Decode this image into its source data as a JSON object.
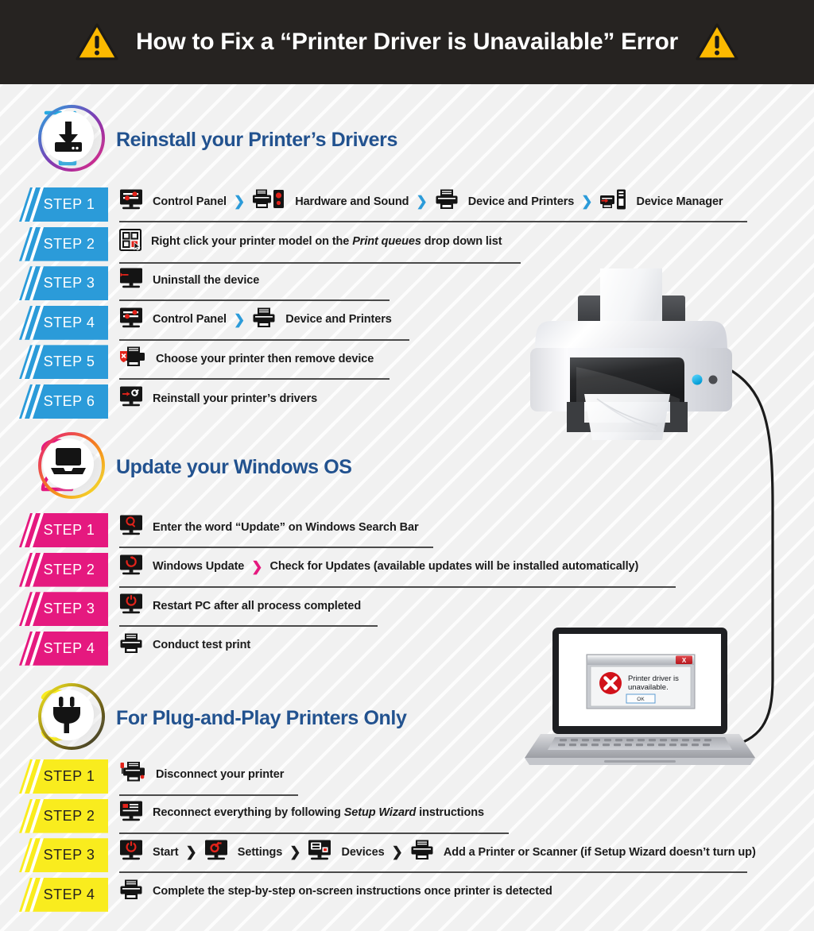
{
  "header": {
    "title": "How to Fix a “Printer Driver is Unavailable” Error",
    "left_icon": "warning-triangle-icon",
    "right_icon": "warning-triangle-icon"
  },
  "colors": {
    "header_bg": "#262321",
    "page_bg": "#f1f1f1",
    "section_title": "#22528f",
    "section1_accent": "#2b9bd9",
    "section2_accent": "#e5197f",
    "section3_accent": "#f9ec1e",
    "warning_yellow": "#fcb900",
    "error_red": "#d91f26"
  },
  "sections": [
    {
      "number": "1",
      "title": "Reinstall your Printer’s Drivers",
      "icon": "download-icon",
      "accent": "#2b9bd9",
      "steps": [
        {
          "badge": "STEP 1",
          "rule_width": 790,
          "parts": [
            {
              "type": "icon",
              "name": "monitor-settings-icon"
            },
            {
              "type": "text",
              "value": "Control Panel"
            },
            {
              "type": "chevron"
            },
            {
              "type": "icon",
              "name": "printer-speaker-icon"
            },
            {
              "type": "text",
              "value": "Hardware and Sound"
            },
            {
              "type": "chevron"
            },
            {
              "type": "icon",
              "name": "printer-icon"
            },
            {
              "type": "text",
              "value": "Device and Printers"
            },
            {
              "type": "chevron"
            },
            {
              "type": "icon",
              "name": "device-manager-icon"
            },
            {
              "type": "text",
              "value": "Device Manager"
            }
          ]
        },
        {
          "badge": "STEP 2",
          "rule_width": 505,
          "parts": [
            {
              "type": "icon",
              "name": "grid-cursor-icon"
            },
            {
              "type": "text",
              "value": "Right click your printer model on the ",
              "italic_after": "Print queues",
              "tail": " drop down list"
            }
          ]
        },
        {
          "badge": "STEP 3",
          "rule_width": 340,
          "parts": [
            {
              "type": "icon",
              "name": "monitor-uninstall-icon"
            },
            {
              "type": "text",
              "value": "Uninstall the device"
            }
          ]
        },
        {
          "badge": "STEP 4",
          "rule_width": 365,
          "parts": [
            {
              "type": "icon",
              "name": "monitor-settings-icon"
            },
            {
              "type": "text",
              "value": "Control Panel"
            },
            {
              "type": "chevron"
            },
            {
              "type": "icon",
              "name": "printer-icon"
            },
            {
              "type": "text",
              "value": "Device and Printers"
            }
          ]
        },
        {
          "badge": "STEP 5",
          "rule_width": 340,
          "parts": [
            {
              "type": "icon",
              "name": "printer-shield-icon"
            },
            {
              "type": "text",
              "value": "Choose your printer then remove device"
            }
          ]
        },
        {
          "badge": "STEP 6",
          "rule_width": 0,
          "parts": [
            {
              "type": "icon",
              "name": "monitor-driver-icon"
            },
            {
              "type": "text",
              "value": "Reinstall your printer’s drivers"
            }
          ]
        }
      ]
    },
    {
      "number": "2",
      "title": "Update your Windows OS",
      "icon": "laptop-icon",
      "accent": "#e5197f",
      "steps": [
        {
          "badge": "STEP 1",
          "rule_width": 395,
          "parts": [
            {
              "type": "icon",
              "name": "monitor-search-icon"
            },
            {
              "type": "text",
              "value": "Enter the word “Update” on Windows Search Bar"
            }
          ]
        },
        {
          "badge": "STEP 2",
          "rule_width": 700,
          "parts": [
            {
              "type": "icon",
              "name": "monitor-refresh-icon"
            },
            {
              "type": "text",
              "value": "Windows Update"
            },
            {
              "type": "chevron"
            },
            {
              "type": "text",
              "value": "Check for Updates (available updates will be installed automatically)"
            }
          ]
        },
        {
          "badge": "STEP 3",
          "rule_width": 325,
          "parts": [
            {
              "type": "icon",
              "name": "monitor-power-icon"
            },
            {
              "type": "text",
              "value": "Restart PC after all process completed"
            }
          ]
        },
        {
          "badge": "STEP 4",
          "rule_width": 0,
          "parts": [
            {
              "type": "icon",
              "name": "printer-icon"
            },
            {
              "type": "text",
              "value": "Conduct test print"
            }
          ]
        }
      ]
    },
    {
      "number": "3",
      "title": "For Plug-and-Play Printers Only",
      "icon": "power-plug-icon",
      "accent": "#f9ec1e",
      "steps": [
        {
          "badge": "STEP 1",
          "rule_width": 225,
          "parts": [
            {
              "type": "icon",
              "name": "printer-disconnect-icon"
            },
            {
              "type": "text",
              "value": "Disconnect your printer"
            }
          ]
        },
        {
          "badge": "STEP 2",
          "rule_width": 490,
          "parts": [
            {
              "type": "icon",
              "name": "monitor-wizard-icon"
            },
            {
              "type": "text",
              "value": "Reconnect everything by following ",
              "italic_after": "Setup Wizard",
              "tail": " instructions"
            }
          ]
        },
        {
          "badge": "STEP 3",
          "rule_width": 790,
          "parts": [
            {
              "type": "icon",
              "name": "monitor-power-icon"
            },
            {
              "type": "text",
              "value": "Start"
            },
            {
              "type": "chevron"
            },
            {
              "type": "icon",
              "name": "monitor-gear-icon"
            },
            {
              "type": "text",
              "value": "Settings"
            },
            {
              "type": "chevron"
            },
            {
              "type": "icon",
              "name": "monitor-devices-icon"
            },
            {
              "type": "text",
              "value": "Devices"
            },
            {
              "type": "chevron"
            },
            {
              "type": "icon",
              "name": "printer-icon"
            },
            {
              "type": "text",
              "value": "Add a Printer or Scanner (if Setup Wizard doesn’t turn up)"
            }
          ]
        },
        {
          "badge": "STEP 4",
          "rule_width": 0,
          "parts": [
            {
              "type": "icon",
              "name": "printer-icon"
            },
            {
              "type": "text",
              "value": "Complete the step-by-step on-screen instructions once printer is detected"
            }
          ]
        }
      ]
    }
  ],
  "illustrations": {
    "printer": {
      "name": "printer-illustration"
    },
    "laptop": {
      "name": "laptop-illustration"
    },
    "cable": {
      "name": "usb-cable-illustration"
    },
    "error_dialog": {
      "message_line1": "Printer driver is",
      "message_line2": "unavailable.",
      "ok_label": "OK",
      "close_label": "X",
      "error_icon": "error-x-icon"
    }
  }
}
